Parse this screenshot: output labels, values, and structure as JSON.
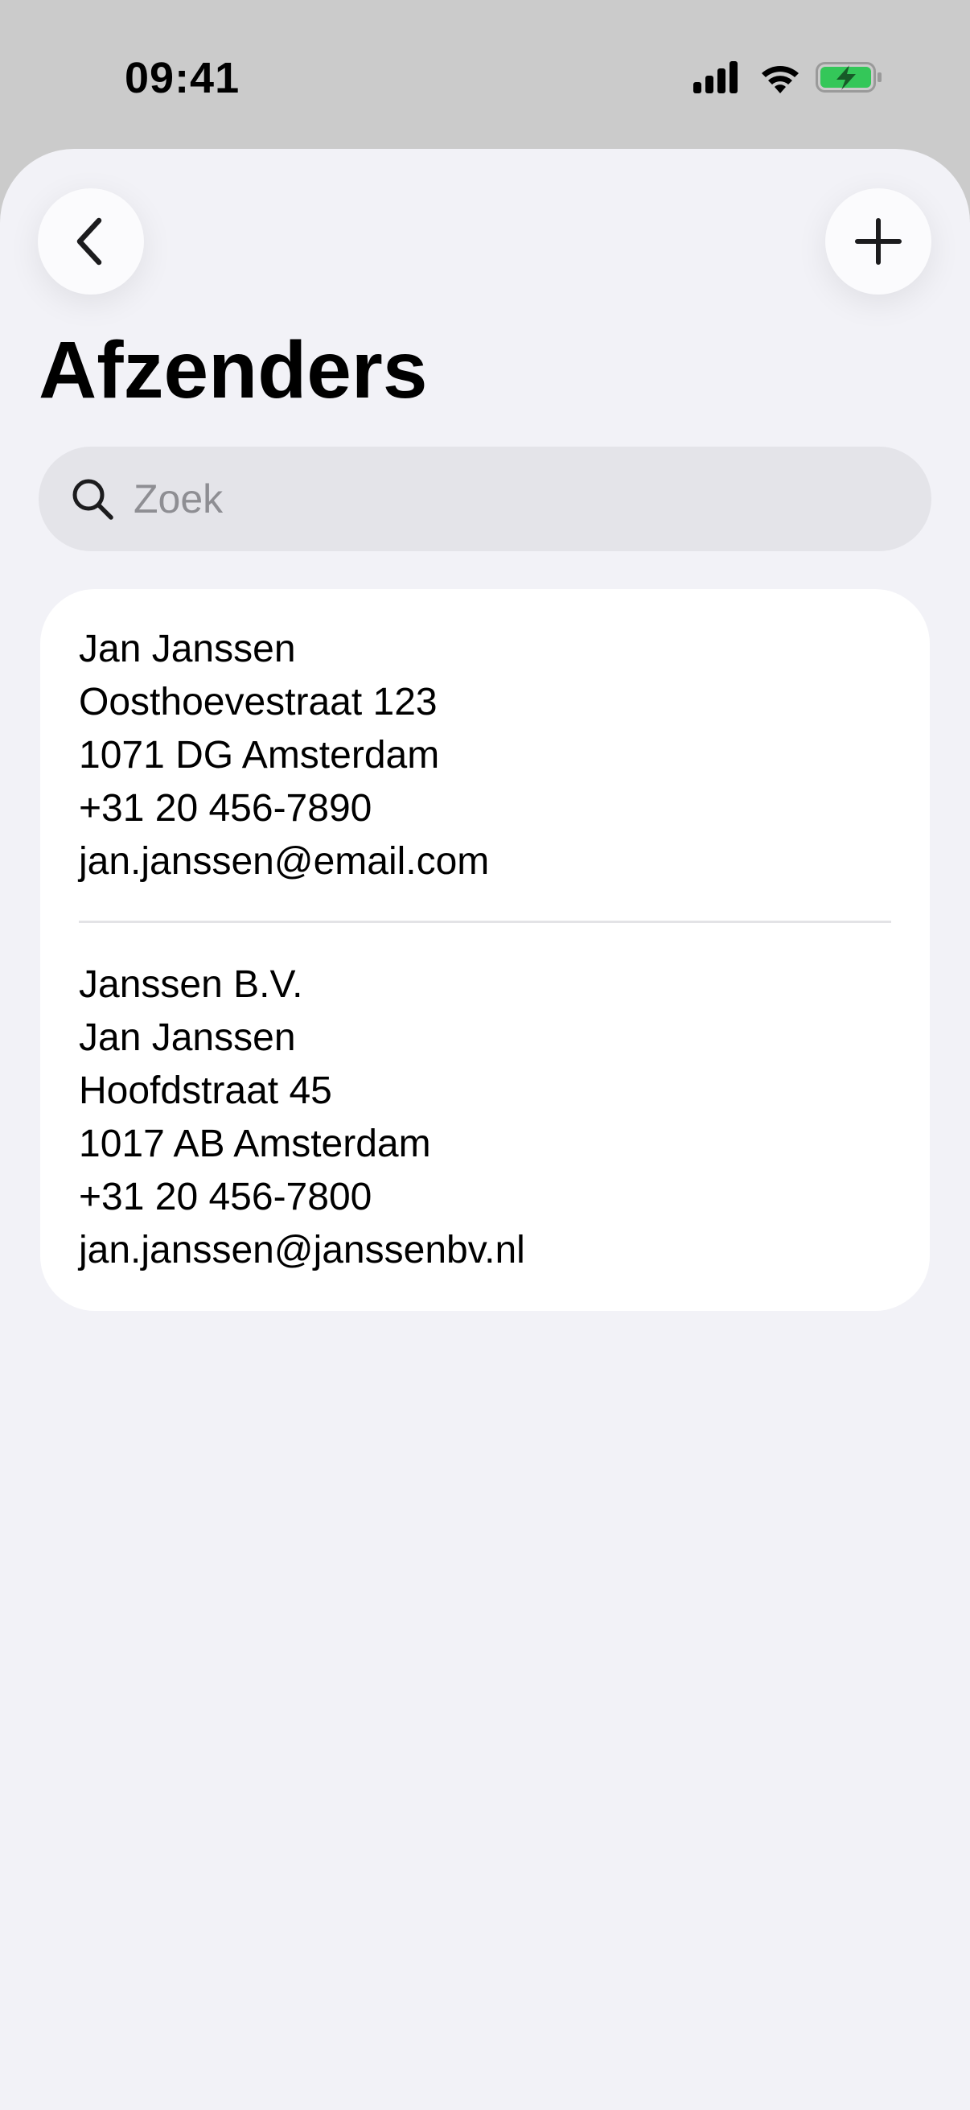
{
  "status_bar": {
    "time": "09:41",
    "icons": [
      "cellular-signal-icon",
      "wifi-icon",
      "battery-charging-icon"
    ],
    "battery_color": "#34c759"
  },
  "nav": {
    "back_icon": "chevron-left-icon",
    "add_icon": "plus-icon"
  },
  "page": {
    "title": "Afzenders"
  },
  "search": {
    "placeholder": "Zoek",
    "value": ""
  },
  "senders": [
    {
      "lines": [
        "Jan Janssen",
        "Oosthoevestraat 123",
        "1071 DG Amsterdam",
        "+31 20 456-7890",
        "jan.janssen@email.com"
      ]
    },
    {
      "lines": [
        "Janssen B.V.",
        "Jan Janssen",
        "Hoofdstraat 45",
        "1017 AB Amsterdam",
        "+31 20 456-7800",
        "jan.janssen@janssenbv.nl"
      ]
    }
  ],
  "colors": {
    "background": "#f2f2f7",
    "card": "#ffffff",
    "search_field": "#e4e4e9",
    "placeholder": "#8e8e93"
  }
}
